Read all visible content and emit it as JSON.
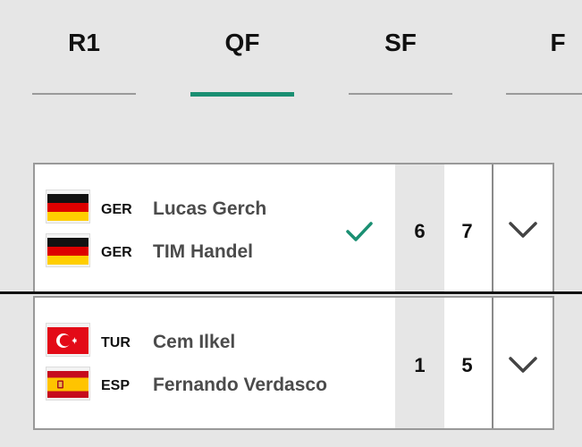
{
  "tabs": [
    {
      "label": "R1",
      "active": false
    },
    {
      "label": "QF",
      "active": true
    },
    {
      "label": "SF",
      "active": false
    },
    {
      "label": "F",
      "active": false
    }
  ],
  "colors": {
    "accent": "#1a8f72",
    "background": "#e6e6e6"
  },
  "matches": [
    {
      "winner_index": 0,
      "players": [
        {
          "code": "GER",
          "name": "Lucas  Gerch",
          "flag": "germany-flag-icon"
        },
        {
          "code": "GER",
          "name": "TIM  Handel",
          "flag": "germany-flag-icon"
        }
      ],
      "sets": [
        "6",
        "7"
      ]
    },
    {
      "winner_index": null,
      "players": [
        {
          "code": "TUR",
          "name": "Cem  Ilkel",
          "flag": "turkey-flag-icon"
        },
        {
          "code": "ESP",
          "name": "Fernando  Verdasco",
          "flag": "spain-flag-icon"
        }
      ],
      "sets": [
        "1",
        "5"
      ]
    }
  ],
  "icons": {
    "winner": "check-icon",
    "expand": "chevron-down-icon"
  }
}
